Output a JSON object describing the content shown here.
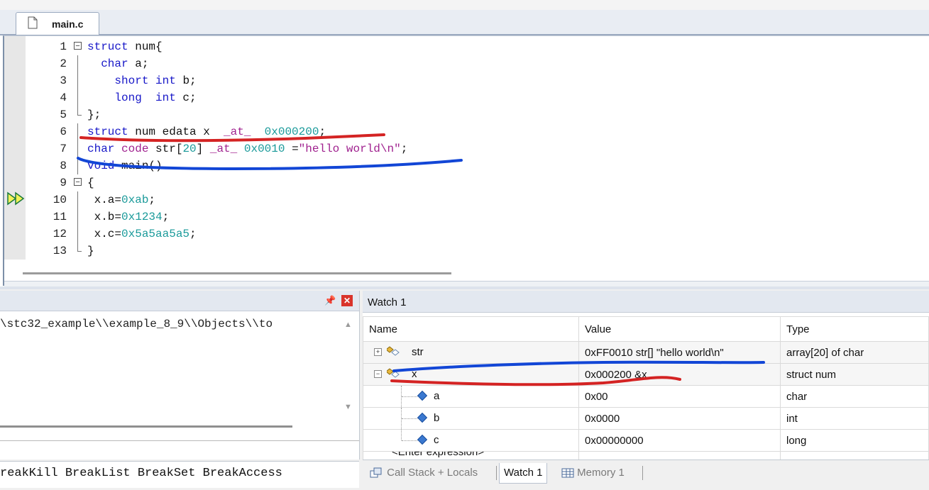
{
  "editor": {
    "tab_label": "main.c",
    "lines": [
      {
        "num": "1",
        "parts": [
          {
            "t": "struct",
            "c": "kw"
          },
          {
            "t": " num{",
            "c": ""
          }
        ]
      },
      {
        "num": "2",
        "parts": [
          {
            "t": "  ",
            "c": ""
          },
          {
            "t": "char",
            "c": "kw"
          },
          {
            "t": " a;",
            "c": ""
          }
        ]
      },
      {
        "num": "3",
        "parts": [
          {
            "t": "    ",
            "c": ""
          },
          {
            "t": "short",
            "c": "kw"
          },
          {
            "t": " ",
            "c": ""
          },
          {
            "t": "int",
            "c": "kw"
          },
          {
            "t": " b;",
            "c": ""
          }
        ]
      },
      {
        "num": "4",
        "parts": [
          {
            "t": "    ",
            "c": ""
          },
          {
            "t": "long",
            "c": "kw"
          },
          {
            "t": "  ",
            "c": ""
          },
          {
            "t": "int",
            "c": "kw"
          },
          {
            "t": " c;",
            "c": ""
          }
        ]
      },
      {
        "num": "5",
        "parts": [
          {
            "t": "};",
            "c": ""
          }
        ]
      },
      {
        "num": "6",
        "parts": [
          {
            "t": "struct",
            "c": "kw"
          },
          {
            "t": " num edata x  ",
            "c": ""
          },
          {
            "t": "_at_",
            "c": "str"
          },
          {
            "t": "  ",
            "c": ""
          },
          {
            "t": "0x000200",
            "c": "num"
          },
          {
            "t": ";",
            "c": ""
          }
        ]
      },
      {
        "num": "7",
        "parts": [
          {
            "t": "char",
            "c": "kw"
          },
          {
            "t": " ",
            "c": ""
          },
          {
            "t": "code",
            "c": "str"
          },
          {
            "t": " str[",
            "c": ""
          },
          {
            "t": "20",
            "c": "num"
          },
          {
            "t": "] ",
            "c": ""
          },
          {
            "t": "_at_",
            "c": "str"
          },
          {
            "t": " ",
            "c": ""
          },
          {
            "t": "0x0010",
            "c": "num"
          },
          {
            "t": " =",
            "c": ""
          },
          {
            "t": "\"hello world\\n\"",
            "c": "str"
          },
          {
            "t": ";",
            "c": ""
          }
        ]
      },
      {
        "num": "8",
        "parts": [
          {
            "t": "void",
            "c": "kw"
          },
          {
            "t": " main()",
            "c": ""
          }
        ]
      },
      {
        "num": "9",
        "parts": [
          {
            "t": "{",
            "c": ""
          }
        ]
      },
      {
        "num": "10",
        "parts": [
          {
            "t": " x.a=",
            "c": ""
          },
          {
            "t": "0xab",
            "c": "num"
          },
          {
            "t": ";",
            "c": ""
          }
        ]
      },
      {
        "num": "11",
        "parts": [
          {
            "t": " x.b=",
            "c": ""
          },
          {
            "t": "0x1234",
            "c": "num"
          },
          {
            "t": ";",
            "c": ""
          }
        ]
      },
      {
        "num": "12",
        "parts": [
          {
            "t": " x.c=",
            "c": ""
          },
          {
            "t": "0x5a5aa5a5",
            "c": "num"
          },
          {
            "t": ";",
            "c": ""
          }
        ]
      },
      {
        "num": "13",
        "parts": [
          {
            "t": "}",
            "c": ""
          }
        ]
      }
    ],
    "current_line": "10"
  },
  "command": {
    "output_line": "\\stc32_example\\\\example_8_9\\\\Objects\\\\to",
    "help_line": "reakKill BreakList BreakSet BreakAccess"
  },
  "watch": {
    "title": "Watch 1",
    "headers": {
      "name": "Name",
      "value": "Value",
      "type": "Type"
    },
    "rows": [
      {
        "name": "str",
        "value": "0xFF0010 str[] \"hello world\\n\"",
        "type": "array[20] of char"
      },
      {
        "name": "x",
        "value": "0x000200 &x",
        "type": "struct num"
      },
      {
        "name": "a",
        "value": "0x00",
        "type": "char"
      },
      {
        "name": "b",
        "value": "0x0000",
        "type": "int"
      },
      {
        "name": "c",
        "value": "0x00000000",
        "type": "long"
      }
    ],
    "enter_expression": "<Enter expression>",
    "tabs": {
      "callstack": "Call Stack + Locals",
      "watch1": "Watch 1",
      "memory1": "Memory 1"
    }
  },
  "colors": {
    "keyword": "#1717c8",
    "number": "#1a9a9a",
    "string": "#a0228f",
    "annotation_red": "#d42323",
    "annotation_blue": "#1246d6"
  }
}
